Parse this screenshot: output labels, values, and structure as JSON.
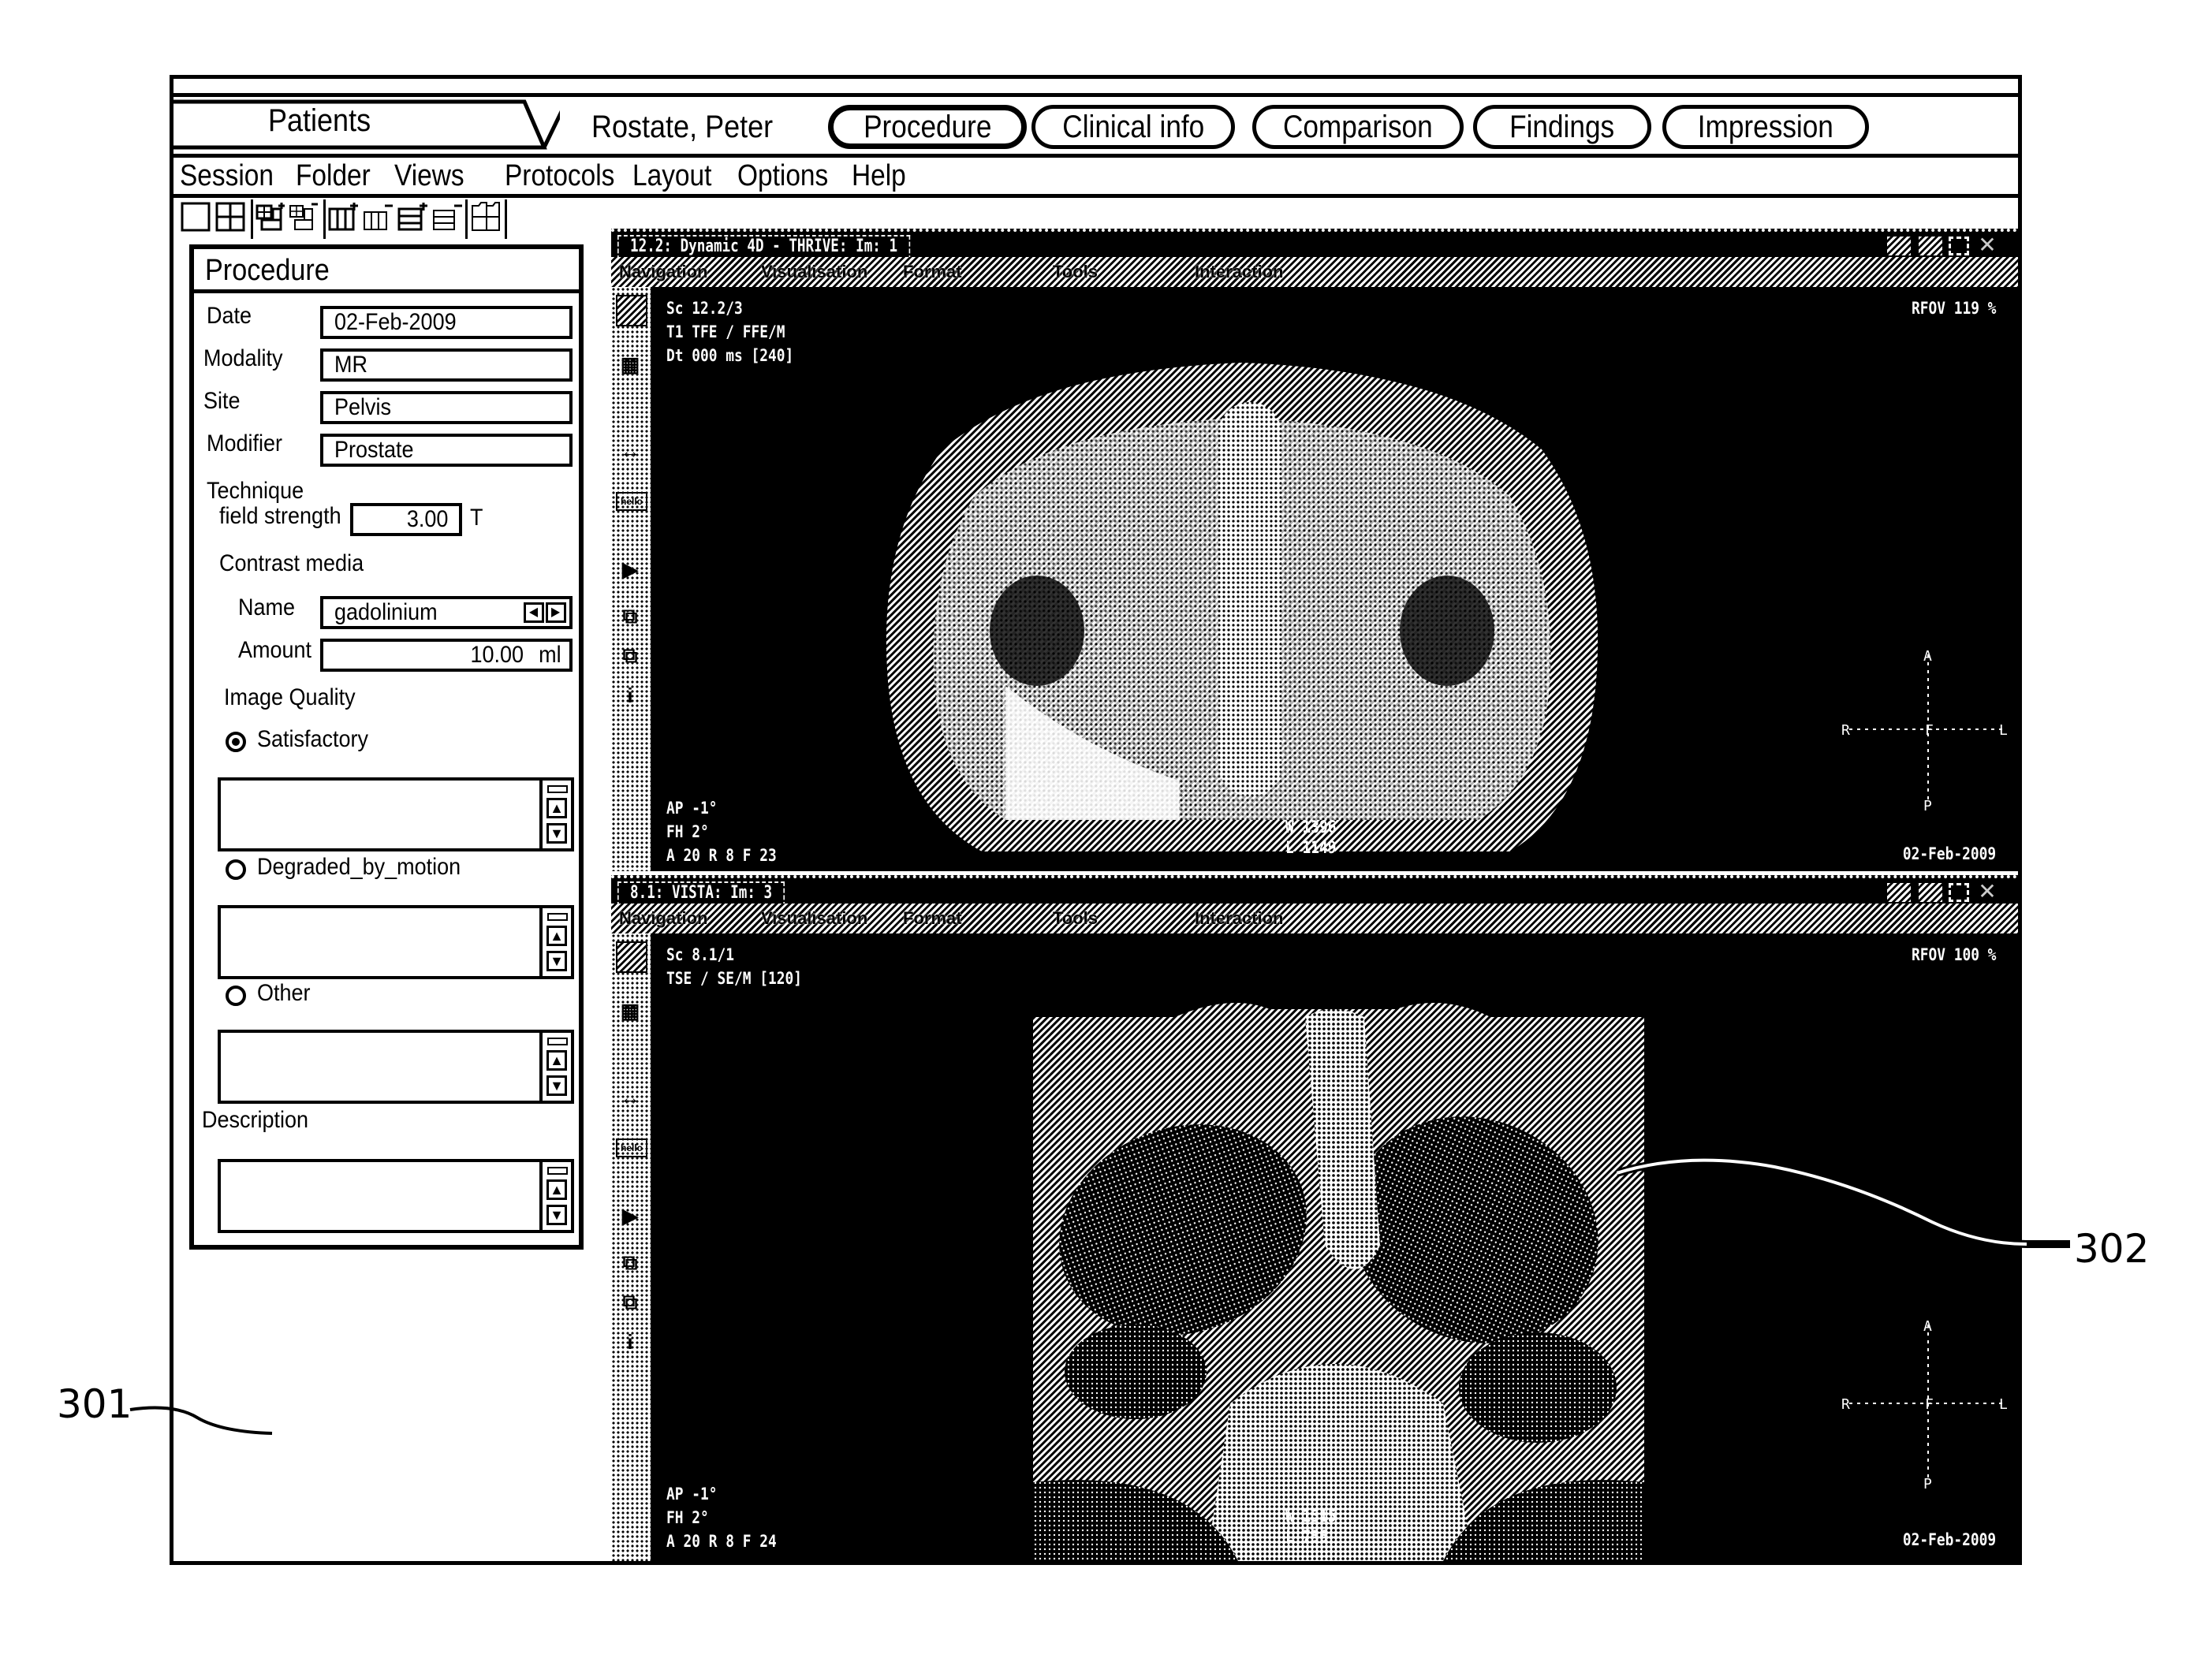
{
  "tabbar": {
    "patients_label": "Patients",
    "patient_name": "Rostate, Peter",
    "tabs": [
      {
        "label": "Procedure",
        "active": true
      },
      {
        "label": "Clinical info",
        "active": false
      },
      {
        "label": "Comparison",
        "active": false
      },
      {
        "label": "Findings",
        "active": false
      },
      {
        "label": "Impression",
        "active": false
      }
    ]
  },
  "menubar": {
    "items": [
      "Session",
      "Folder",
      "Views",
      "Protocols",
      "Layout",
      "Options",
      "Help"
    ]
  },
  "toolbar": {
    "icons": [
      "layout-1x1-icon",
      "layout-2x2-icon",
      "add-grid-icon",
      "remove-grid-icon",
      "add-column-icon",
      "remove-column-icon",
      "add-row-icon",
      "remove-row-icon",
      "layout-split-icon"
    ]
  },
  "procedure": {
    "title": "Procedure",
    "date_label": "Date",
    "date_value": "02-Feb-2009",
    "modality_label": "Modality",
    "modality_value": "MR",
    "site_label": "Site",
    "site_value": "Pelvis",
    "modifier_label": "Modifier",
    "modifier_value": "Prostate",
    "technique_label": "Technique",
    "field_strength_label": "field strength",
    "field_strength_value": "3.00",
    "field_strength_unit": "T",
    "contrast_label": "Contrast media",
    "contrast_name_label": "Name",
    "contrast_name_value": "gadolinium",
    "contrast_amount_label": "Amount",
    "contrast_amount_value": "10.00",
    "contrast_amount_unit": "ml",
    "image_quality_label": "Image Quality",
    "quality_options": [
      {
        "label": "Satisfactory",
        "selected": true
      },
      {
        "label": "Degraded_by_motion",
        "selected": false
      },
      {
        "label": "Other",
        "selected": false
      }
    ],
    "description_label": "Description"
  },
  "viewers": [
    {
      "title": "12.2: Dynamic 4D - THRIVE: Im: 1",
      "menu": [
        "Navigation",
        "Visualisation",
        "Format",
        "Tools",
        "Interaction"
      ],
      "overlay_tl": [
        "Sc 12.2/3",
        "T1 TFE / FFE/M",
        "Dt 000 ms [240]"
      ],
      "overlay_tr": "RFOV 119 %",
      "overlay_bl": [
        "AP -1°",
        "FH 2°",
        "A 20 R 8 F 23"
      ],
      "overlay_bc": [
        "W 1396",
        "L 1149"
      ],
      "overlay_br": "02-Feb-2009",
      "orientation": {
        "left": "R",
        "right": "L",
        "top": "A",
        "bottom": "P",
        "center": "F"
      }
    },
    {
      "title": "8.1: VISTA: Im: 3",
      "menu": [
        "Navigation",
        "Visualisation",
        "Format",
        "Tools",
        "Interaction"
      ],
      "overlay_tl": [
        "Sc 8.1/1",
        "TSE / SE/M [120]"
      ],
      "overlay_tr": "RFOV 100 %",
      "overlay_bl": [
        "AP -1°",
        "FH 2°",
        "A 20 R 8 F 24"
      ],
      "overlay_bc": [
        "W 1515",
        "L 756"
      ],
      "overlay_br": "02-Feb-2009",
      "orientation": {
        "left": "R",
        "right": "L",
        "top": "A",
        "bottom": "P",
        "center": "F"
      }
    }
  ],
  "side_icons": [
    "window-level-icon",
    "layout-grid-icon",
    "measure-distance-icon",
    "annotation-text-icon",
    "cine-play-icon",
    "copy-viewport-icon",
    "swap-viewport-icon",
    "info-icon"
  ],
  "callouts": {
    "c301": "301",
    "c302": "302"
  }
}
